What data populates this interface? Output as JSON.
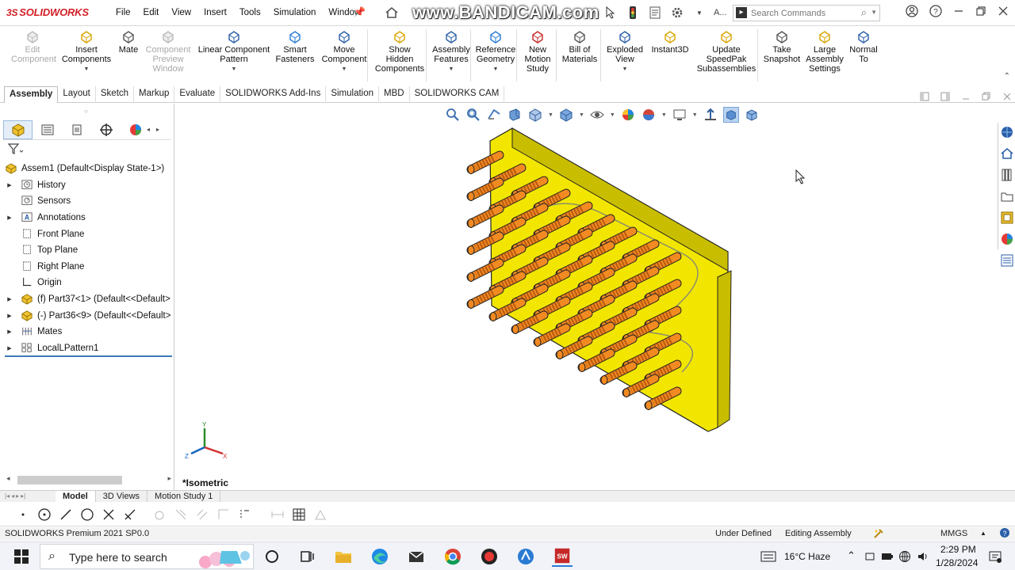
{
  "app": {
    "logo_ds": "3S",
    "logo_text": "SOLIDWORKS",
    "watermark": "www.BANDICAM.com"
  },
  "menus": [
    "File",
    "Edit",
    "View",
    "Insert",
    "Tools",
    "Simulation",
    "Window"
  ],
  "title_extra": "A...",
  "search": {
    "placeholder": "Search Commands"
  },
  "commands": [
    {
      "label": "Edit\nComponent",
      "disabled": true,
      "icon": "edit-component-icon"
    },
    {
      "label": "Insert\nComponents",
      "disabled": false,
      "icon": "insert-components-icon"
    },
    {
      "label": "Mate",
      "disabled": false,
      "icon": "mate-icon"
    },
    {
      "label": "Component\nPreview\nWindow",
      "disabled": true,
      "icon": "component-preview-icon"
    },
    {
      "label": "Linear Component\nPattern",
      "disabled": false,
      "icon": "linear-pattern-icon"
    },
    {
      "label": "Smart\nFasteners",
      "disabled": false,
      "icon": "smart-fasteners-icon"
    },
    {
      "label": "Move\nComponent",
      "disabled": false,
      "icon": "move-component-icon"
    },
    {
      "label": "Show\nHidden\nComponents",
      "disabled": false,
      "icon": "show-hidden-icon"
    },
    {
      "label": "Assembly\nFeatures",
      "disabled": false,
      "icon": "assembly-features-icon"
    },
    {
      "label": "Reference\nGeometry",
      "disabled": false,
      "icon": "reference-geometry-icon"
    },
    {
      "label": "New\nMotion\nStudy",
      "disabled": false,
      "icon": "motion-study-icon"
    },
    {
      "label": "Bill of\nMaterials",
      "disabled": false,
      "icon": "bill-of-materials-icon"
    },
    {
      "label": "Exploded\nView",
      "disabled": false,
      "icon": "exploded-view-icon"
    },
    {
      "label": "Instant3D",
      "disabled": false,
      "icon": "instant3d-icon"
    },
    {
      "label": "Update\nSpeedPak\nSubassemblies",
      "disabled": false,
      "icon": "speedpak-icon"
    },
    {
      "label": "Take\nSnapshot",
      "disabled": false,
      "icon": "snapshot-icon"
    },
    {
      "label": "Large\nAssembly\nSettings",
      "disabled": false,
      "icon": "large-assembly-icon"
    },
    {
      "label": "Normal\nTo",
      "disabled": false,
      "icon": "normal-to-icon"
    }
  ],
  "tabs": [
    "Assembly",
    "Layout",
    "Sketch",
    "Markup",
    "Evaluate",
    "SOLIDWORKS Add-Ins",
    "Simulation",
    "MBD",
    "SOLIDWORKS CAM"
  ],
  "tree": [
    {
      "label": "Assem1  (Default<Display State-1>)",
      "icon": "assembly-icon",
      "expander": false,
      "root": true
    },
    {
      "label": "History",
      "icon": "history-icon",
      "expander": true
    },
    {
      "label": "Sensors",
      "icon": "sensors-icon",
      "expander": false
    },
    {
      "label": "Annotations",
      "icon": "annotations-icon",
      "expander": true
    },
    {
      "label": "Front Plane",
      "icon": "plane-icon",
      "expander": false
    },
    {
      "label": "Top Plane",
      "icon": "plane-icon",
      "expander": false
    },
    {
      "label": "Right Plane",
      "icon": "plane-icon",
      "expander": false
    },
    {
      "label": "Origin",
      "icon": "origin-icon",
      "expander": false
    },
    {
      "label": "(f) Part37<1> (Default<<Default>",
      "icon": "part-icon",
      "expander": true
    },
    {
      "label": "(-) Part36<9> (Default<<Default>",
      "icon": "part-icon",
      "expander": true
    },
    {
      "label": "Mates",
      "icon": "mates-icon",
      "expander": true
    },
    {
      "label": "LocalLPattern1",
      "icon": "pattern-icon",
      "expander": true
    }
  ],
  "view": {
    "label": "*Isometric"
  },
  "bottom_tabs": [
    "Model",
    "3D Views",
    "Motion Study 1"
  ],
  "status": {
    "product": "SOLIDWORKS Premium 2021 SP0.0",
    "defined": "Under Defined",
    "mode": "Editing Assembly",
    "units": "MMGS",
    "units_arrow": "▲"
  },
  "taskbar": {
    "search_placeholder": "Type here to search",
    "weather": "16°C  Haze",
    "time": "2:29 PM",
    "date": "1/28/2024"
  },
  "colors": {
    "plate": "#f2e600",
    "plate_dark": "#c9bd00",
    "pin": "#f28a22",
    "pin_dark": "#b85a10",
    "logo_red": "#d32027",
    "tree_rollback": "#3d7ab8"
  }
}
